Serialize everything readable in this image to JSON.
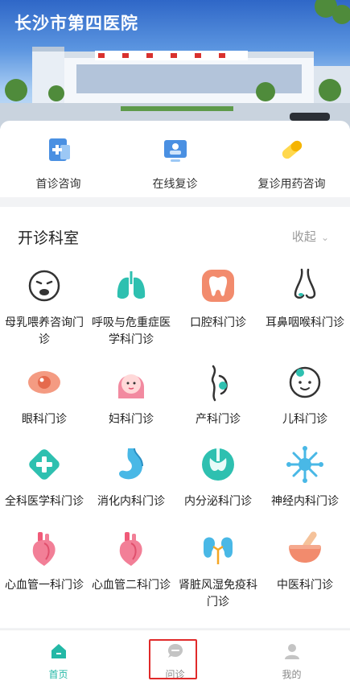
{
  "header": {
    "title": "长沙市第四医院"
  },
  "services": [
    {
      "label": "首诊咨询",
      "icon": "clipboard-plus-icon"
    },
    {
      "label": "在线复诊",
      "icon": "monitor-doctor-icon"
    },
    {
      "label": "复诊用药咨询",
      "icon": "pill-capsule-icon"
    }
  ],
  "departments": {
    "title": "开诊科室",
    "collapse_label": "收起",
    "items": [
      {
        "label": "母乳喂养咨询门诊",
        "icon": "baby-crying-icon"
      },
      {
        "label": "呼吸与危重症医学科门诊",
        "icon": "lungs-icon"
      },
      {
        "label": "口腔科门诊",
        "icon": "tooth-icon"
      },
      {
        "label": "耳鼻咽喉科门诊",
        "icon": "nose-icon"
      },
      {
        "label": "眼科门诊",
        "icon": "eye-icon"
      },
      {
        "label": "妇科门诊",
        "icon": "woman-face-icon"
      },
      {
        "label": "产科门诊",
        "icon": "pregnant-icon"
      },
      {
        "label": "儿科门诊",
        "icon": "baby-face-icon"
      },
      {
        "label": "全科医学科门诊",
        "icon": "medical-cross-icon"
      },
      {
        "label": "消化内科门诊",
        "icon": "stomach-icon"
      },
      {
        "label": "内分泌科门诊",
        "icon": "thyroid-icon"
      },
      {
        "label": "神经内科门诊",
        "icon": "neuron-icon"
      },
      {
        "label": "心血管一科门诊",
        "icon": "heart-organ-icon"
      },
      {
        "label": "心血管二科门诊",
        "icon": "heart-organ-icon"
      },
      {
        "label": "肾脏风湿免疫科门诊",
        "icon": "kidneys-icon"
      },
      {
        "label": "中医科门诊",
        "icon": "mortar-pestle-icon"
      }
    ]
  },
  "tabbar": {
    "items": [
      {
        "label": "首页",
        "icon": "home-icon",
        "active": true
      },
      {
        "label": "问诊",
        "icon": "chat-bubble-icon",
        "active": false
      },
      {
        "label": "我的",
        "icon": "user-icon",
        "active": false
      }
    ]
  },
  "colors": {
    "accent": "#23b8a6",
    "highlight": "#e02a2a"
  }
}
